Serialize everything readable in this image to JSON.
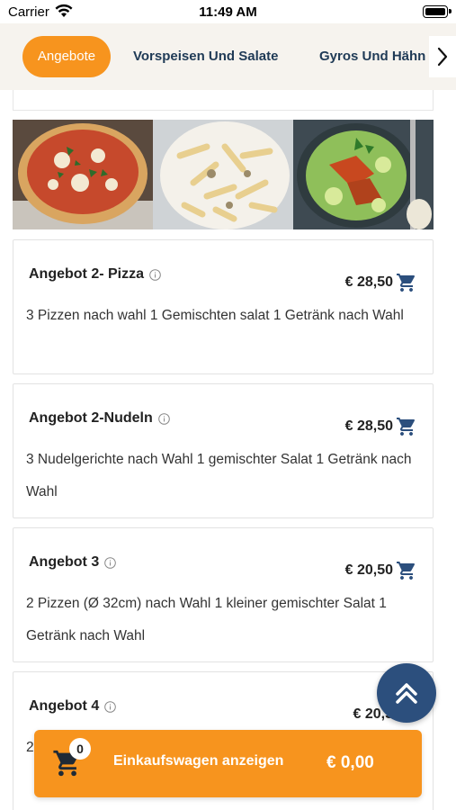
{
  "status_bar": {
    "carrier": "Carrier",
    "time": "11:49 AM"
  },
  "tabs": [
    {
      "label": "Angebote",
      "active": true
    },
    {
      "label": "Vorspeisen Und Salate",
      "active": false
    },
    {
      "label": "Gyros Und Hähn",
      "active": false
    }
  ],
  "offers": [
    {
      "title": "Angebot 2- Pizza",
      "price": "€ 28,50",
      "description": "3 Pizzen nach wahl 1 Gemischten salat 1 Getränk nach Wahl"
    },
    {
      "title": "Angebot 2-Nudeln",
      "price": "€ 28,50",
      "description": "3 Nudelgerichte nach Wahl 1 gemischter Salat 1 Getränk nach Wahl"
    },
    {
      "title": "Angebot 3",
      "price": "€ 20,50",
      "description": "2 Pizzen (Ø 32cm) nach Wahl 1 kleiner gemischter Salat 1 Getränk nach Wahl"
    },
    {
      "title": "Angebot 4",
      "price": "€ 20,5",
      "description": "2"
    }
  ],
  "cart": {
    "count": "0",
    "label": "Einkaufswagen anzeigen",
    "total": "€ 0,00"
  },
  "colors": {
    "accent": "#f7941e",
    "navy": "#1f3a56",
    "scroll_button": "#2c4f7d"
  }
}
